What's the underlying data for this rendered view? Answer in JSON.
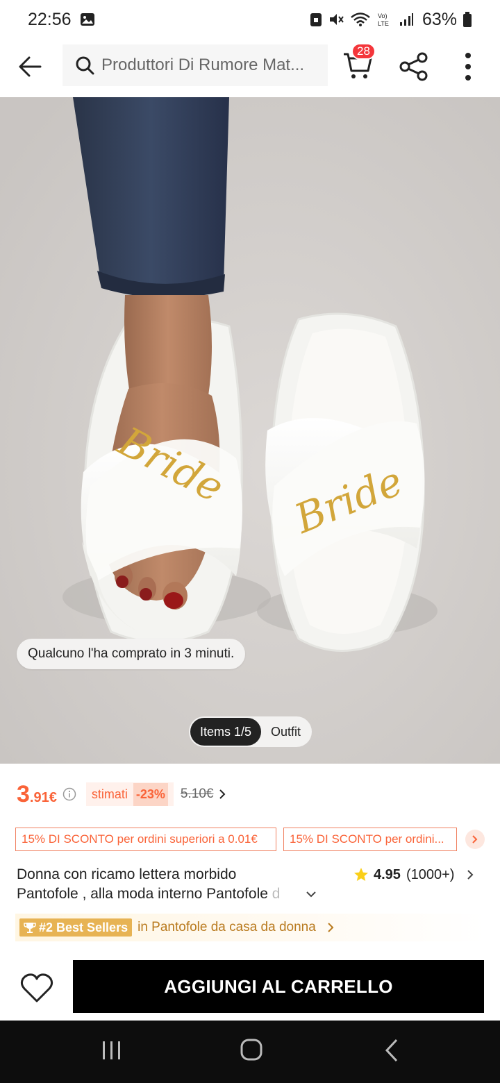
{
  "status_bar": {
    "time": "22:56",
    "battery": "63%",
    "network_label": "LTE"
  },
  "header": {
    "search_placeholder": "Produttori Di Rumore Mat...",
    "cart_count": "28"
  },
  "product_image": {
    "recent_purchase": "Qualcuno l'ha comprato in 3 minuti.",
    "tabs": [
      {
        "label": "Items 1/5",
        "active": true
      },
      {
        "label": "Outfit",
        "active": false
      }
    ],
    "embroidery_text": "Bride"
  },
  "price": {
    "main": "3",
    "decimals": ".91€",
    "estimate_label": "stimati",
    "discount": "-23%",
    "original": "5.10€"
  },
  "coupons": [
    "15% DI SCONTO per ordini superiori a 0.01€",
    "15% DI SCONTO per ordini..."
  ],
  "product": {
    "title_line1": "Donna con ricamo lettera morbido",
    "title_line2": "Pantofole , alla moda interno Pantofole",
    "title_fade": " d",
    "rating": "4.95",
    "rating_count": "(1000+)"
  },
  "best_seller": {
    "badge": "#2 Best Sellers",
    "text": "in Pantofole da casa da donna"
  },
  "actions": {
    "add_to_cart": "AGGIUNGI AL CARRELLO"
  },
  "colors": {
    "accent": "#fa6338",
    "badge_red": "#f4363b",
    "best_seller_gold": "#e7b354",
    "cta_black": "#000000"
  }
}
